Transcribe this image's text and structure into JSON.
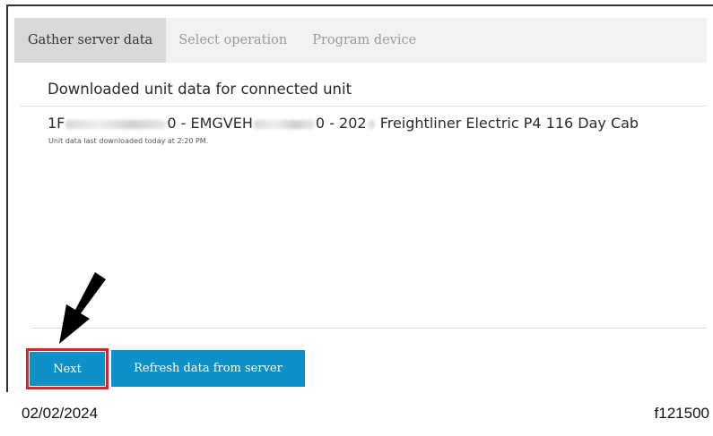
{
  "tabs": [
    {
      "label": "Gather server data",
      "active": true
    },
    {
      "label": "Select operation",
      "active": false
    },
    {
      "label": "Program device",
      "active": false
    }
  ],
  "unit_section": {
    "title": "Downloaded unit data for connected unit",
    "vin_start": "1F",
    "vin_end": "0 - EMGVEH",
    "model_part": "0 - 202",
    "model_name": "Freightliner Electric P4 116 Day Cab",
    "subtext": "Unit data last downloaded today at 2:20 PM."
  },
  "buttons": {
    "next_label": "Next",
    "refresh_label": "Refresh data from server"
  },
  "footer": {
    "date": "02/02/2024",
    "figure_id": "f121500"
  },
  "colors": {
    "accent": "#0e90c8",
    "highlight": "#e0202a",
    "tab_bar": "#f2f2f2",
    "tab_active": "#d9d9d9"
  },
  "icons": {
    "pointer": "arrow-pointer-icon"
  }
}
